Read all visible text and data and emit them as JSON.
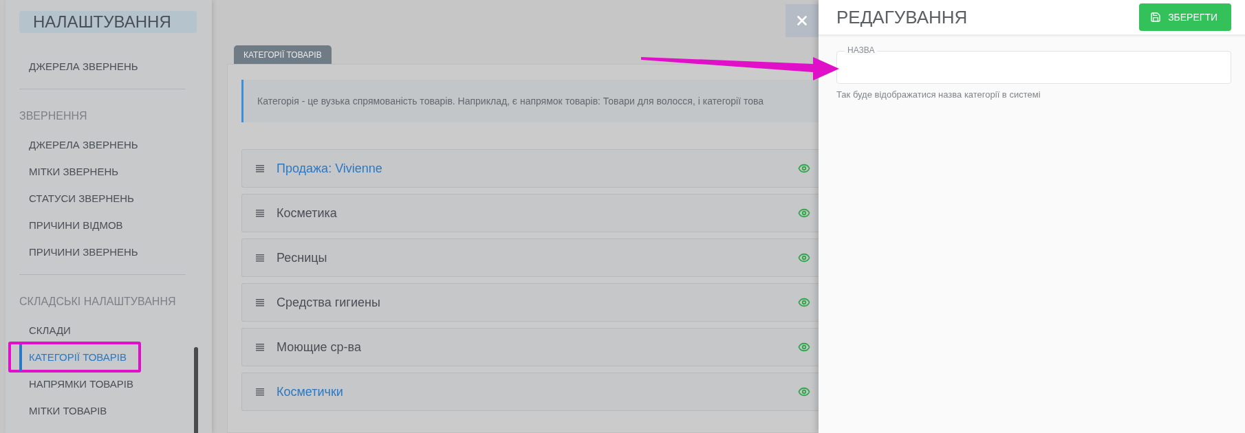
{
  "sidebar": {
    "title": "НАЛАШТУВАННЯ",
    "groups": [
      {
        "items": [
          {
            "label": "ДЖЕРЕЛА ЗВЕРНЕНЬ",
            "selected": false
          }
        ]
      },
      {
        "heading": "ЗВЕРНЕННЯ",
        "items": [
          {
            "label": "ДЖЕРЕЛА ЗВЕРНЕНЬ",
            "selected": false
          },
          {
            "label": "МІТКИ ЗВЕРНЕНЬ",
            "selected": false
          },
          {
            "label": "СТАТУСИ ЗВЕРНЕНЬ",
            "selected": false
          },
          {
            "label": "ПРИЧИНИ ВІДМОВ",
            "selected": false
          },
          {
            "label": "ПРИЧИНИ ЗВЕРНЕНЬ",
            "selected": false
          }
        ]
      },
      {
        "heading": "СКЛАДСЬКІ НАЛАШТУВАННЯ",
        "items": [
          {
            "label": "СКЛАДИ",
            "selected": false
          },
          {
            "label": "КАТЕГОРІЇ ТОВАРІВ",
            "selected": true
          },
          {
            "label": "НАПРЯМКИ ТОВАРІВ",
            "selected": false
          },
          {
            "label": "МІТКИ ТОВАРІВ",
            "selected": false
          }
        ]
      }
    ]
  },
  "main": {
    "tab": "КАТЕГОРІЇ ТОВАРІВ",
    "info": "Категорія - це вузька спрямованість товарів. Наприклад, є напрямок товарів: Товари для волосся, і категорії това",
    "categories": [
      {
        "name": "Продажа: Vivienne",
        "linked": true
      },
      {
        "name": "Косметика",
        "linked": false
      },
      {
        "name": "Ресницы",
        "linked": false
      },
      {
        "name": "Средства гигиены",
        "linked": false
      },
      {
        "name": "Моющие ср-ва",
        "linked": false
      },
      {
        "name": "Косметички",
        "linked": true
      }
    ]
  },
  "editor": {
    "title": "РЕДАГУВАННЯ",
    "save_button": "ЗБЕРЕГТИ",
    "field": {
      "label": "НАЗВА",
      "hint": "Так буде відображатися назва категорії в системі"
    }
  }
}
